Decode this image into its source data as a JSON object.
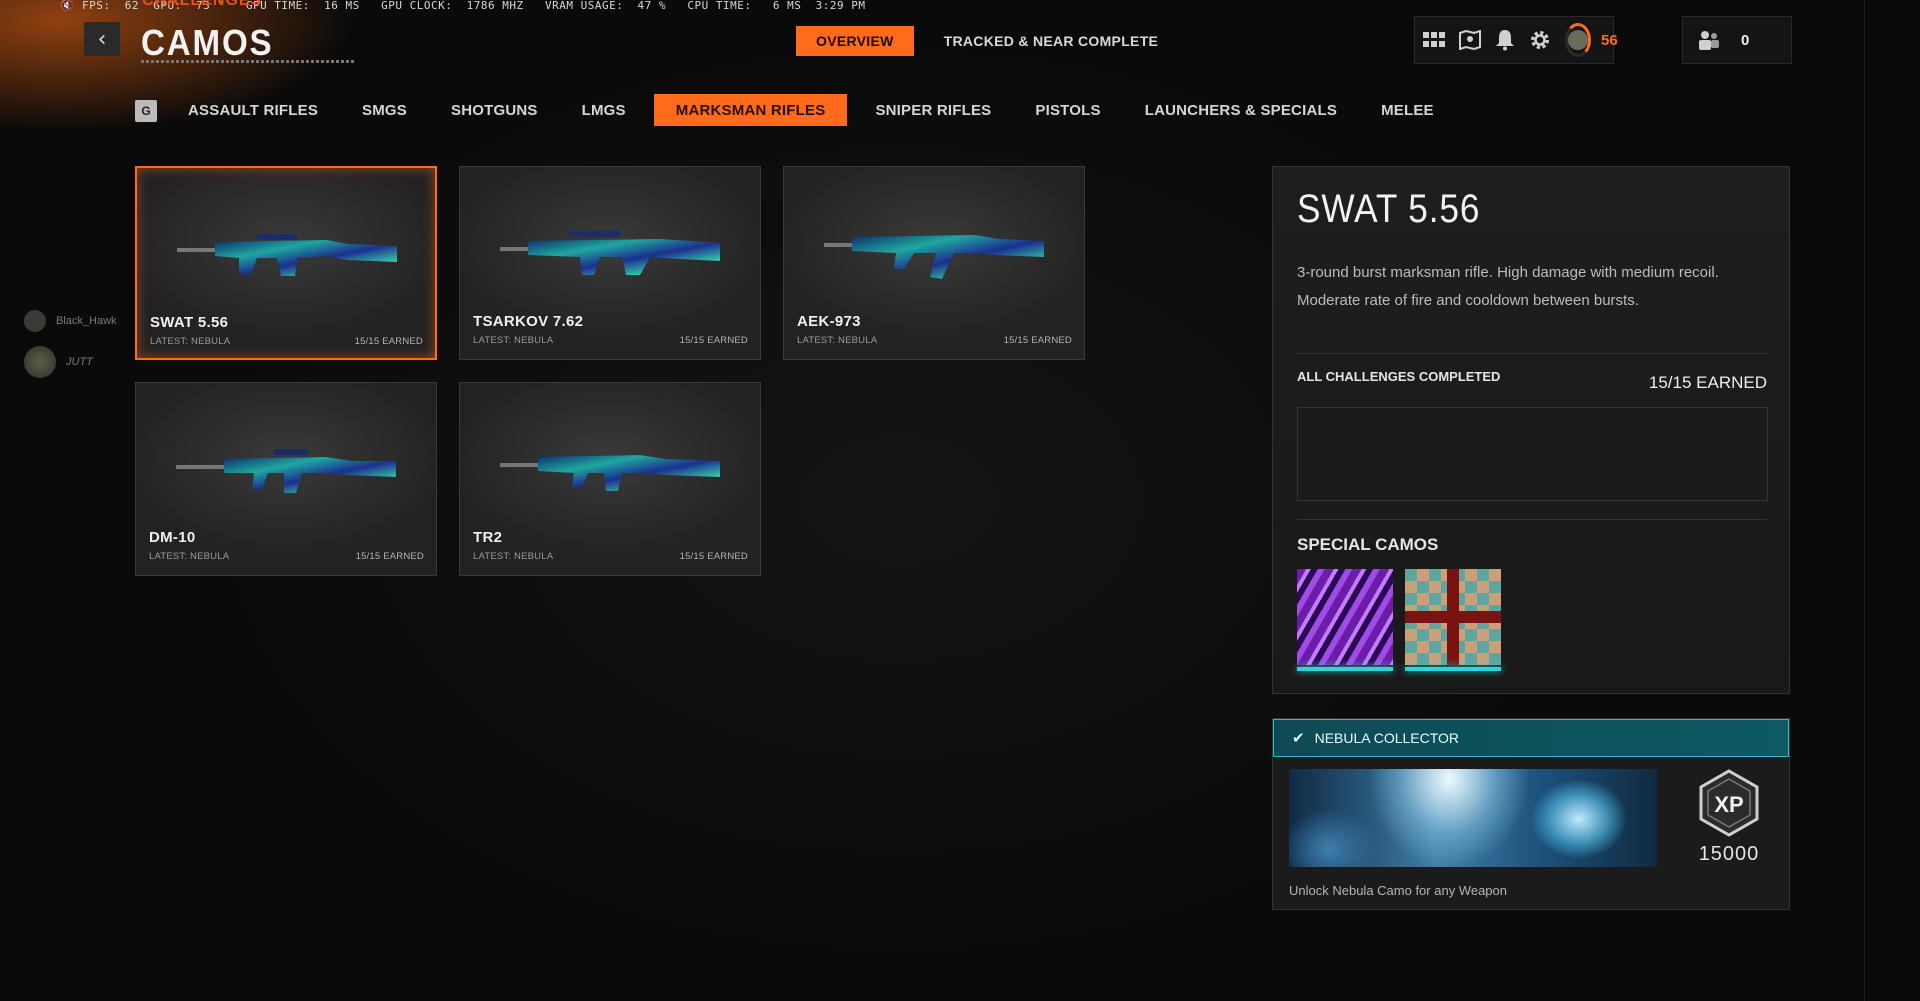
{
  "perf": {
    "text": "FPS:  62  GPU:  73 °   GPU TIME:  16 MS   GPU CLOCK:  1786 MHZ   VRAM USAGE:  47 %   CPU TIME:   6 MS  3:29 PM"
  },
  "header": {
    "subtitle": "CHALLENGES",
    "title": "CAMOS",
    "tabs": [
      {
        "label": "OVERVIEW",
        "active": true
      },
      {
        "label": "TRACKED & NEAR COMPLETE",
        "active": false
      }
    ],
    "rank": "56",
    "party_count": "0"
  },
  "categories": {
    "key_hint": "G",
    "items": [
      {
        "label": "ASSAULT RIFLES"
      },
      {
        "label": "SMGS"
      },
      {
        "label": "SHOTGUNS"
      },
      {
        "label": "LMGS"
      },
      {
        "label": "MARKSMAN RIFLES",
        "active": true
      },
      {
        "label": "SNIPER RIFLES"
      },
      {
        "label": "PISTOLS"
      },
      {
        "label": "LAUNCHERS & SPECIALS"
      },
      {
        "label": "MELEE"
      }
    ]
  },
  "social": {
    "player1": "Black_Hawk",
    "player2": "JUTT"
  },
  "weapons": [
    {
      "name": "SWAT 5.56",
      "sub": "LATEST: NEBULA",
      "earned": "15/15 EARNED"
    },
    {
      "name": "TSARKOV 7.62",
      "sub": "LATEST: NEBULA",
      "earned": "15/15 EARNED"
    },
    {
      "name": "AEK-973",
      "sub": "LATEST: NEBULA",
      "earned": "15/15 EARNED"
    },
    {
      "name": "DM-10",
      "sub": "LATEST: NEBULA",
      "earned": "15/15 EARNED"
    },
    {
      "name": "TR2",
      "sub": "LATEST: NEBULA",
      "earned": "15/15 EARNED"
    }
  ],
  "detail": {
    "title": "SWAT 5.56",
    "description": "3-round burst marksman rifle.  High damage with medium recoil. Moderate rate of fire and cooldown between bursts.",
    "challenges_label": "ALL CHALLENGES COMPLETED",
    "challenges_earned": "15/15 EARNED",
    "special_label": "SPECIAL CAMOS"
  },
  "reward": {
    "title": "NEBULA COLLECTOR",
    "caption": "Unlock Nebula Camo for any Weapon",
    "xp": "15000",
    "xp_badge": "XP"
  },
  "colors": {
    "accent": "#ff6b1a",
    "teal": "#2fd3d8"
  }
}
